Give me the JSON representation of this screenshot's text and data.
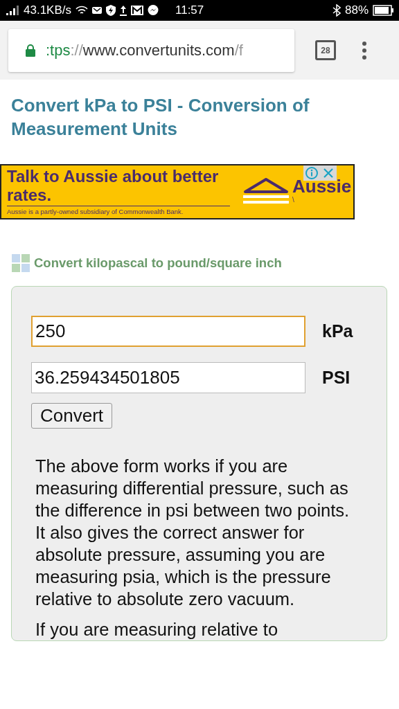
{
  "status_bar": {
    "speed": "43.1KB/s",
    "time": "11:57",
    "battery": "88%"
  },
  "browser": {
    "url": {
      "scheme": ":tps",
      "separator": "://",
      "host": "www.convertunits.com",
      "path": "/f"
    },
    "tab_count": "28"
  },
  "page_title": "Convert kPa to PSI - Conversion of Measurement Units",
  "ad": {
    "headline": "Talk to Aussie about better rates.",
    "disclaimer": "Aussie is a partly-owned subsidiary of Commonwealth Bank.",
    "logo": "Aussie",
    "mark": "\\"
  },
  "converter": {
    "heading": "Convert kilopascal to pound/square inch",
    "fields": [
      {
        "value": "250",
        "unit": "kPa",
        "focused": true
      },
      {
        "value": "36.259434501805",
        "unit": "PSI",
        "focused": false
      }
    ],
    "button": "Convert",
    "paragraphs": [
      "The above form works if you are measuring differential pressure, such as the difference in psi between two points. It also gives the correct answer for absolute pressure, assuming you are measuring psia, which is the pressure relative to absolute zero vacuum.",
      "If you are measuring relative to"
    ]
  }
}
